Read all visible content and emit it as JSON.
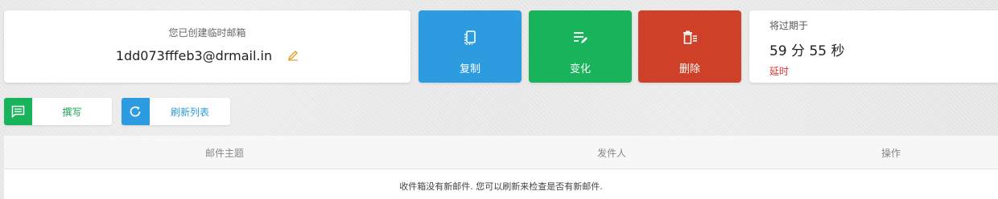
{
  "email": {
    "label": "您已创建临时邮箱",
    "address": "1dd073fffeb3@drmail.in"
  },
  "actions": {
    "copy": "复制",
    "change": "变化",
    "delete": "删除"
  },
  "timer": {
    "label": "将过期于",
    "value": "59 分 55 秒",
    "extend": "延时"
  },
  "toolbar": {
    "compose": "撰写",
    "refresh": "刷新列表"
  },
  "table": {
    "columns": [
      "邮件主题",
      "发件人",
      "操作"
    ],
    "empty_message": "收件箱没有新邮件. 您可以刷新来检查是否有新邮件."
  },
  "colors": {
    "blue": "#2d9be0",
    "green": "#18b35b",
    "red": "#cf4029"
  }
}
